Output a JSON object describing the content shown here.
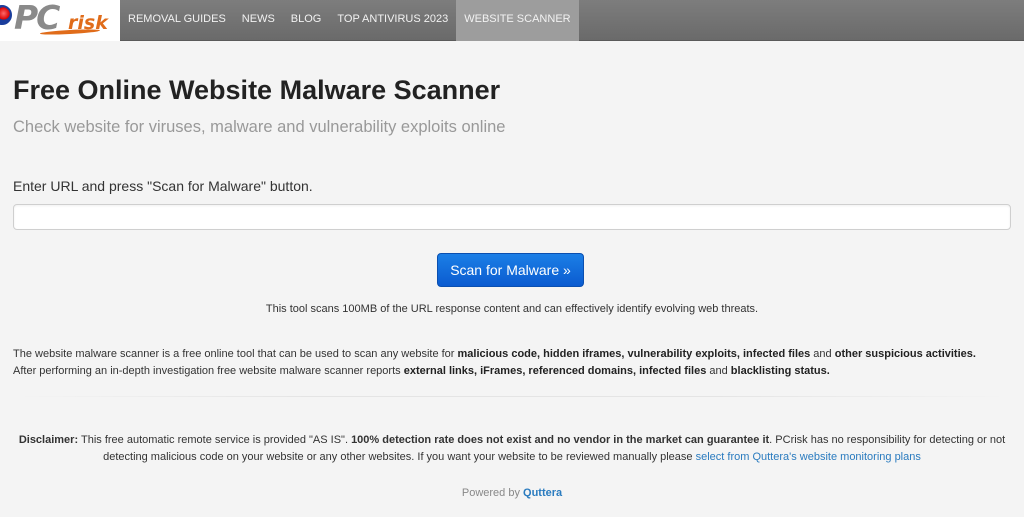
{
  "header": {
    "logo": {
      "pc": "PC",
      "risk": "risk"
    },
    "nav": [
      {
        "label": "REMOVAL GUIDES",
        "active": false
      },
      {
        "label": "NEWS",
        "active": false
      },
      {
        "label": "BLOG",
        "active": false
      },
      {
        "label": "TOP ANTIVIRUS 2023",
        "active": false
      },
      {
        "label": "WEBSITE SCANNER",
        "active": true
      }
    ]
  },
  "main": {
    "title": "Free Online Website Malware Scanner",
    "subtitle": "Check website for viruses, malware and vulnerability exploits online",
    "url_label": "Enter URL and press \"Scan for Malware\" button.",
    "url_value": "",
    "scan_button": "Scan for Malware »",
    "tool_note": "This tool scans 100MB of the URL response content and can effectively identify evolving web threats.",
    "description": {
      "p1": "The website malware scanner is a free online tool that can be used to scan any website for ",
      "b1": "malicious code, hidden iframes, vulnerability exploits, infected files",
      "p2": " and ",
      "b2": "other suspicious activities.",
      "p3": "After performing an in-depth investigation free website malware scanner reports ",
      "b3": "external links, iFrames, referenced domains, infected files",
      "p4": " and ",
      "b4": "blacklisting status."
    },
    "disclaimer": {
      "label": "Disclaimer:",
      "t1": " This free automatic remote service is provided \"AS IS\". ",
      "b1": "100% detection rate does not exist and no vendor in the market can guarantee it",
      "t2": ". PCrisk has no responsibility for detecting or not detecting malicious code on your website or any other websites. If you want your website to be reviewed manually please ",
      "link": "select from Quttera's website monitoring plans"
    },
    "powered": {
      "text": "Powered by ",
      "link": "Quttera"
    }
  },
  "colors": {
    "accent": "#0b5bd0",
    "link": "#2a7bbf",
    "nav_bg": "#737373",
    "logo_orange": "#e06c1a"
  }
}
